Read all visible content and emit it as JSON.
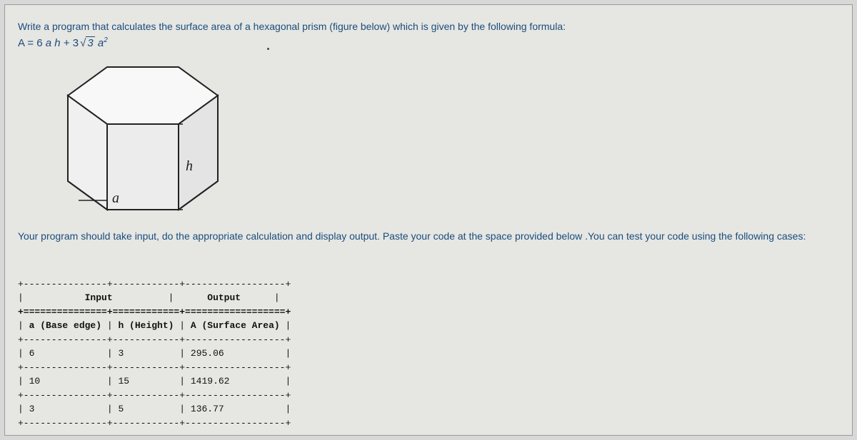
{
  "prompt": {
    "line1": "Write a program that calculates the surface area of a  hexagonal prism (figure below) which is given by the following formula:",
    "formula_plain": "A = 6 a h + 3√3 a²",
    "line2": "Your program should take input, do the appropriate calculation and display output. Paste your code at the space provided below .You can test your code using the following cases:"
  },
  "figure": {
    "label_h": "h",
    "label_a": "a"
  },
  "table": {
    "header_input": "Input",
    "header_output": "Output",
    "col_a": "a (Base edge)",
    "col_h": "h (Height)",
    "col_area": "A (Surface Area)",
    "rows": [
      {
        "a": "6",
        "h": "3",
        "area": "295.06"
      },
      {
        "a": "10",
        "h": "15",
        "area": "1419.62"
      },
      {
        "a": "3",
        "h": "5",
        "area": "136.77"
      }
    ]
  }
}
